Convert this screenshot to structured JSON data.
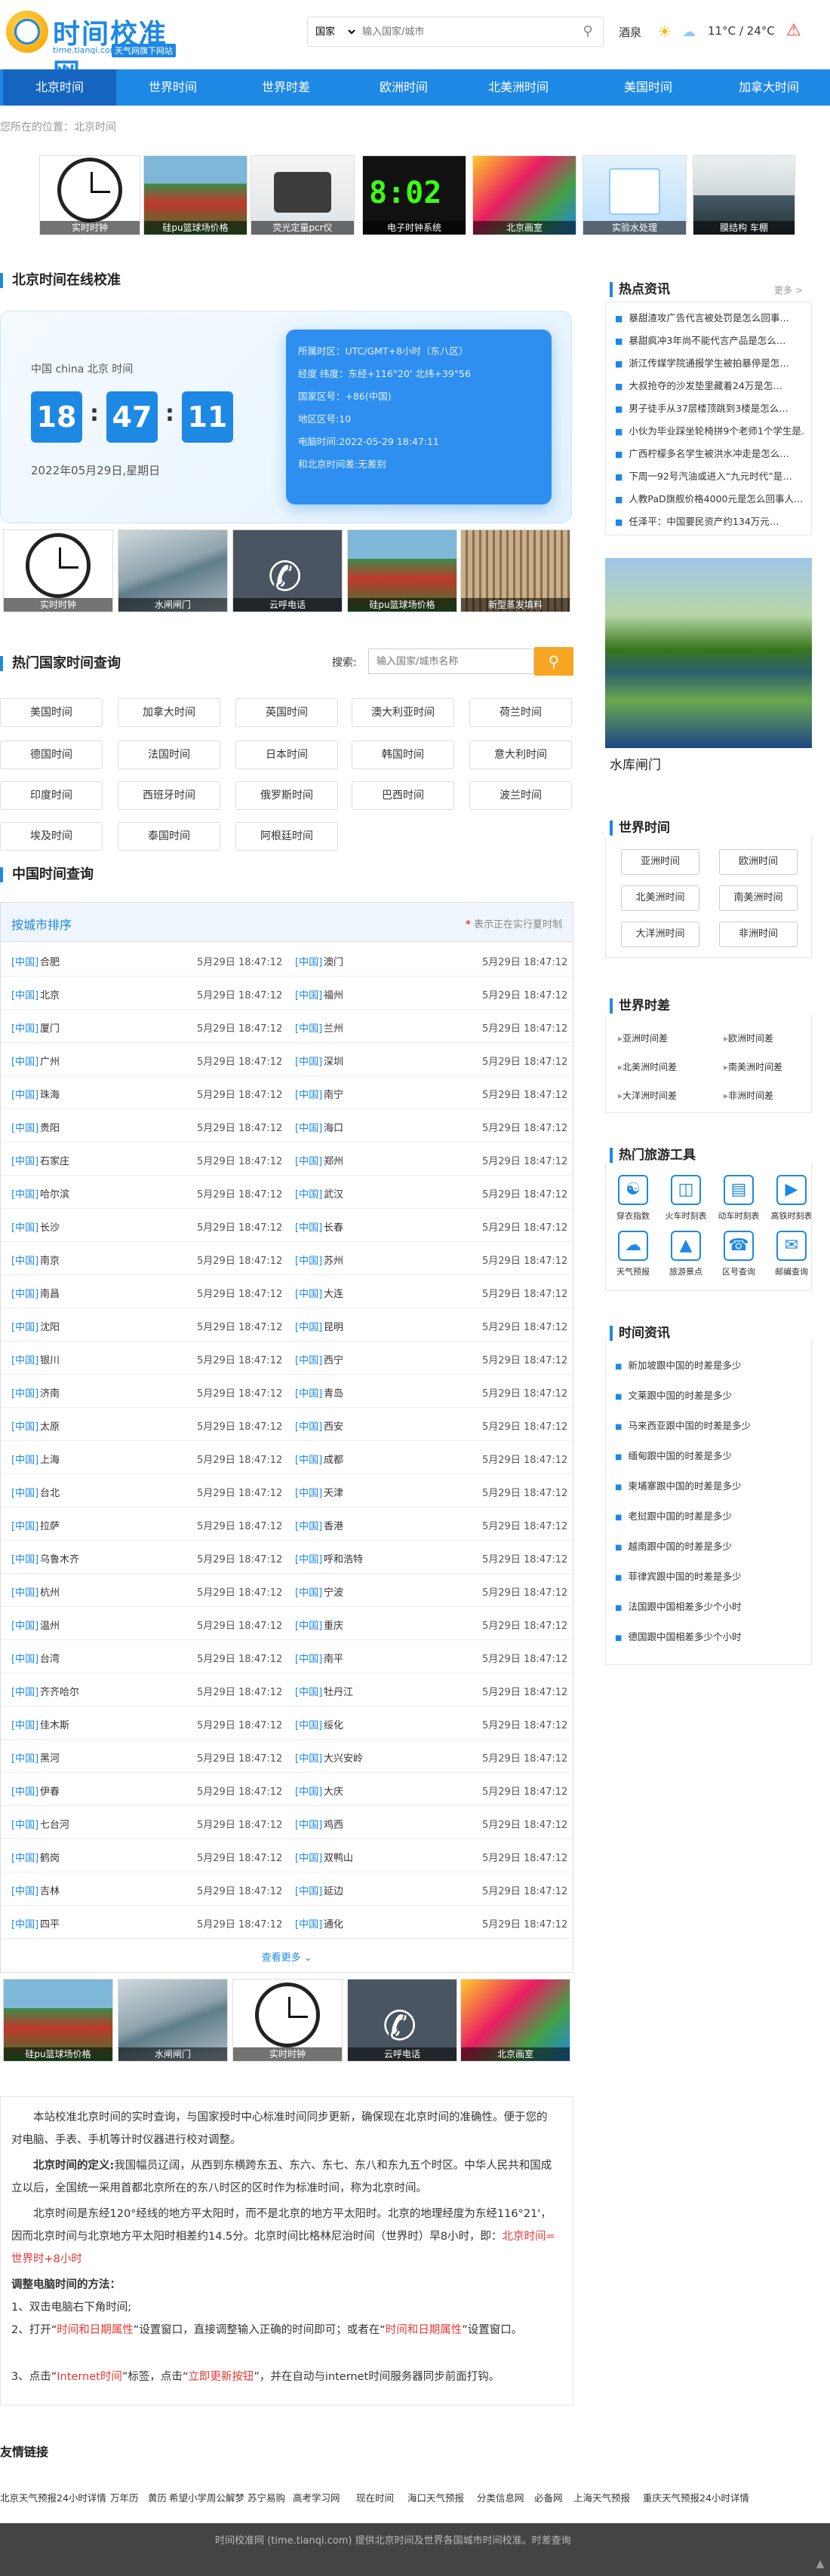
{
  "header": {
    "site_title": "时间校准网",
    "domain": "time.tianqi.com",
    "badge": "天气网旗下网站",
    "search_select": "国家",
    "search_placeholder": "输入国家/城市",
    "weather_city": "酒泉",
    "weather_temp": "11°C / 24°C",
    "weather_warn_icon": "warning-icon"
  },
  "nav": [
    "北京时间",
    "世界时间",
    "世界时差",
    "欧洲时间",
    "北美洲时间",
    "美国时间",
    "加拿大时间"
  ],
  "breadcrumb": "您所在的位置：北京时间",
  "top_thumbs": [
    "实时时钟",
    "硅pu篮球场价格",
    "荧光定量pcr仪",
    "电子时钟系统",
    "北京画室",
    "实验水处理",
    "膜结构 车棚"
  ],
  "beijing": {
    "title": "北京时间在线校准",
    "city": "中国 china 北京 时间",
    "hh": "18",
    "mm": "47",
    "ss": "11",
    "date": "2022年05月29日,星期日",
    "info": [
      "所属时区：UTC/GMT+8小时（东八区）",
      "经度 纬度：东经+116°20' 北纬+39°56",
      "国家区号：+86(中国)",
      "地区区号:10",
      "电脑时间:2022-05-29 18:47:11",
      "和北京时间差:无差别"
    ]
  },
  "mid_thumbs": [
    "实时时钟",
    "水闸闸门",
    "云呼电话",
    "硅pu篮球场价格",
    "新型蒸发填料"
  ],
  "hot_countries": {
    "title": "热门国家时间查询",
    "search_label": "搜索:",
    "search_placeholder": "输入国家/城市名称",
    "items": [
      "美国时间",
      "加拿大时间",
      "英国时间",
      "澳大利亚时间",
      "荷兰时间",
      "德国时间",
      "法国时间",
      "日本时间",
      "韩国时间",
      "意大利时间",
      "印度时间",
      "西班牙时间",
      "俄罗斯时间",
      "巴西时间",
      "波兰时间",
      "埃及时间",
      "泰国时间",
      "阿根廷时间"
    ]
  },
  "china_table": {
    "title": "中国时间查询",
    "sort_label": "按城市排序",
    "note_star": "*",
    "note": "表示正在实行夏时制",
    "tag": "[中国]",
    "time": "5月29日 18:47:12",
    "left": [
      "合肥",
      "北京",
      "厦门",
      "广州",
      "珠海",
      "贵阳",
      "石家庄",
      "哈尔滨",
      "长沙",
      "南京",
      "南昌",
      "沈阳",
      "银川",
      "济南",
      "太原",
      "上海",
      "台北",
      "拉萨",
      "乌鲁木齐",
      "杭州",
      "温州",
      "台湾",
      "齐齐哈尔",
      "佳木斯",
      "黑河",
      "伊春",
      "七台河",
      "鹤岗",
      "吉林",
      "四平"
    ],
    "right": [
      "澳门",
      "福州",
      "兰州",
      "深圳",
      "南宁",
      "海口",
      "郑州",
      "武汉",
      "长春",
      "苏州",
      "大连",
      "昆明",
      "西宁",
      "青岛",
      "西安",
      "成都",
      "天津",
      "香港",
      "呼和浩特",
      "宁波",
      "重庆",
      "南平",
      "牡丹江",
      "绥化",
      "大兴安岭",
      "大庆",
      "鸡西",
      "双鸭山",
      "延边",
      "通化"
    ],
    "more": "查看更多"
  },
  "bottom_thumbs": [
    "硅pu篮球场价格",
    "水闸闸门",
    "实时时钟",
    "云呼电话",
    "北京画室"
  ],
  "info": {
    "p1": "本站校准北京时间的实时查询，与国家授时中心标准时间同步更新，确保现在北京时间的准确性。便于您的对电脑、手表、手机等计时仪器进行校对调整。",
    "p2_label": "北京时间的定义:",
    "p2": "我国幅员辽阔，从西到东横跨东五、东六、东七、东八和东九五个时区。中华人民共和国成立以后，全国统一采用首都北京所在的东八时区的区时作为标准时间，称为北京时间。",
    "p3": "北京时间是东经120°经线的地方平太阳时，而不是北京的地方平太阳时。北京的地理经度为东经116°21'，因而北京时间与北京地方平太阳时相差约14.5分。北京时间比格林尼治时间（世界时）早8小时，即：",
    "p3_red": "北京时间=世界时+8小时",
    "p4": "调整电脑时间的方法：",
    "s1": "1、双击电脑右下角时间;",
    "s2a": "2、打开“",
    "s2r": "时间和日期属性",
    "s2b": "”设置窗口，直接调整输入正确的时间即可；或者在“",
    "s2r2": "时间和日期属性",
    "s2c": "”设置窗口。",
    "s3a": "3、点击“",
    "s3r": "Internet时间",
    "s3b": "”标签，点击“",
    "s3r2": "立即更新按钮",
    "s3c": "”，并在自动与internet时间服务器同步前面打钩。"
  },
  "friend_links": {
    "title": "友情链接",
    "items": [
      "北京天气预报24小时详情",
      "万年历",
      "黄历",
      "希望小学",
      "周公解梦",
      "苏宁易购",
      "高考学习网",
      "现在时间",
      "海口天气预报",
      "分类信息网",
      "必备网",
      "上海天气预报",
      "重庆天气预报24小时详情"
    ]
  },
  "footer": "时间校准网 (time.tianqi.com) 提供北京时间及世界各国城市时间校准。时差查询",
  "right": {
    "hot_news_title": "热点资讯",
    "more": "更多 >",
    "hot_news": [
      "暴甜渣攻广告代言被处罚是怎么回事…",
      "暴甜疯冲3年尚不能代言产品是怎么…",
      "浙江传媒学院通报学生被拍暴停是怎…",
      "大叔抢夺的沙发垫里藏着24万是怎…",
      "男子徒手从37层楼顶跳到3楼是怎么…",
      "小伙为毕业踩坐轮椅拼9个老师1个学生是…",
      "广西柠檬多名学生被洪水冲走是怎么…",
      "下周一92号汽油或进入“九元时代”是…",
      "人教PaD旗舰价格4000元是怎么回事人…",
      "任泽平：中国要民资产约134万元…"
    ],
    "dam_caption": "水库闸门",
    "world_time_title": "世界时间",
    "world_time": [
      "亚洲时间",
      "欧洲时间",
      "北美洲时间",
      "南美洲时间",
      "大洋洲时间",
      "非洲时间"
    ],
    "world_diff_title": "世界时差",
    "world_diff": [
      "亚洲时间差",
      "欧洲时间差",
      "北美洲时间差",
      "南美洲时间差",
      "大洋洲时间差",
      "非洲时间差"
    ],
    "tools_title": "热门旅游工具",
    "tools": [
      "穿衣指数",
      "火车时刻表",
      "动车时刻表",
      "高铁时刻表",
      "天气预报",
      "旅游景点",
      "区号查询",
      "邮编查询"
    ],
    "time_news_title": "时间资讯",
    "time_news": [
      "新加坡跟中国的时差是多少",
      "文莱跟中国的时差是多少",
      "马来西亚跟中国的时差是多少",
      "缅甸跟中国的时差是多少",
      "柬埔寨跟中国的时差是多少",
      "老挝跟中国的时差是多少",
      "越南跟中国的时差是多少",
      "菲律宾跟中国的时差是多少",
      "法国跟中国相差多少个小时",
      "德国跟中国相差多少个小时"
    ]
  }
}
